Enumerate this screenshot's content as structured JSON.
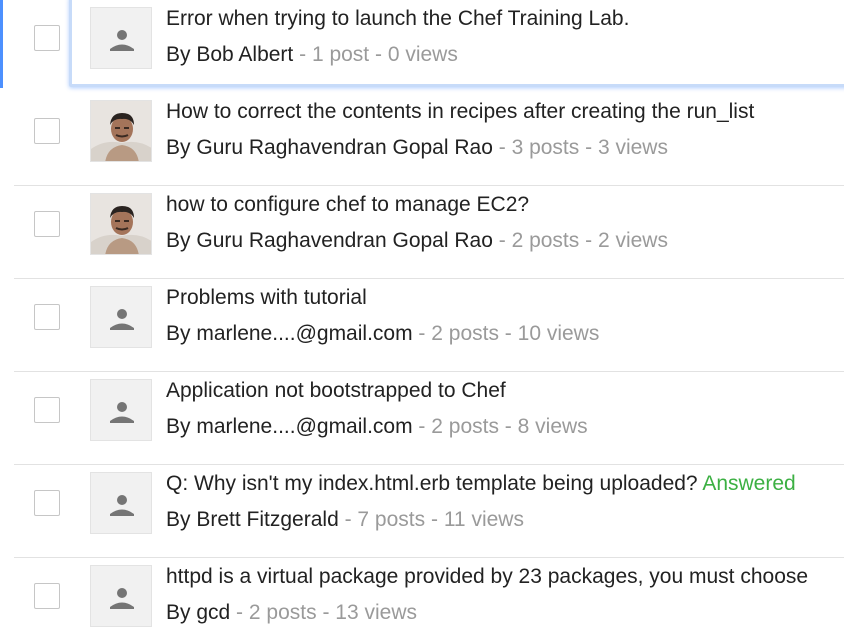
{
  "threads": [
    {
      "title": "Error when trying to launch the Chef Training Lab.",
      "answer": "",
      "by": "By",
      "author": "Bob Albert",
      "posts": "1 post",
      "views": "0 views",
      "avatar": "default",
      "selected": true
    },
    {
      "title": "How to correct the contents in recipes after creating the run_list",
      "answer": "",
      "by": "By",
      "author": "Guru Raghavendran Gopal Rao",
      "posts": "3 posts",
      "views": "3 views",
      "avatar": "photo",
      "selected": false
    },
    {
      "title": "how to configure chef to manage EC2?",
      "answer": "",
      "by": "By",
      "author": "Guru Raghavendran Gopal Rao",
      "posts": "2 posts",
      "views": "2 views",
      "avatar": "photo",
      "selected": false
    },
    {
      "title": "Problems with tutorial",
      "answer": "",
      "by": "By",
      "author": "marlene....@gmail.com",
      "posts": "2 posts",
      "views": "10 views",
      "avatar": "default",
      "selected": false
    },
    {
      "title": "Application not bootstrapped to Chef",
      "answer": "",
      "by": "By",
      "author": "marlene....@gmail.com",
      "posts": "2 posts",
      "views": "8 views",
      "avatar": "default",
      "selected": false
    },
    {
      "title": "Q: Why isn't my index.html.erb template being uploaded?",
      "answer": "Answered",
      "by": "By",
      "author": "Brett Fitzgerald",
      "posts": "7 posts",
      "views": "11 views",
      "avatar": "default",
      "selected": false
    },
    {
      "title": "httpd is a virtual package provided by 23 packages, you must choose",
      "answer": "",
      "by": "By",
      "author": "gcd",
      "posts": "2 posts",
      "views": "13 views",
      "avatar": "default",
      "selected": false
    }
  ],
  "separator": " - ",
  "colors": {
    "accent": "#4d90fe",
    "answer": "#3cb043",
    "meta": "#9a9a9a",
    "text": "#222222"
  }
}
